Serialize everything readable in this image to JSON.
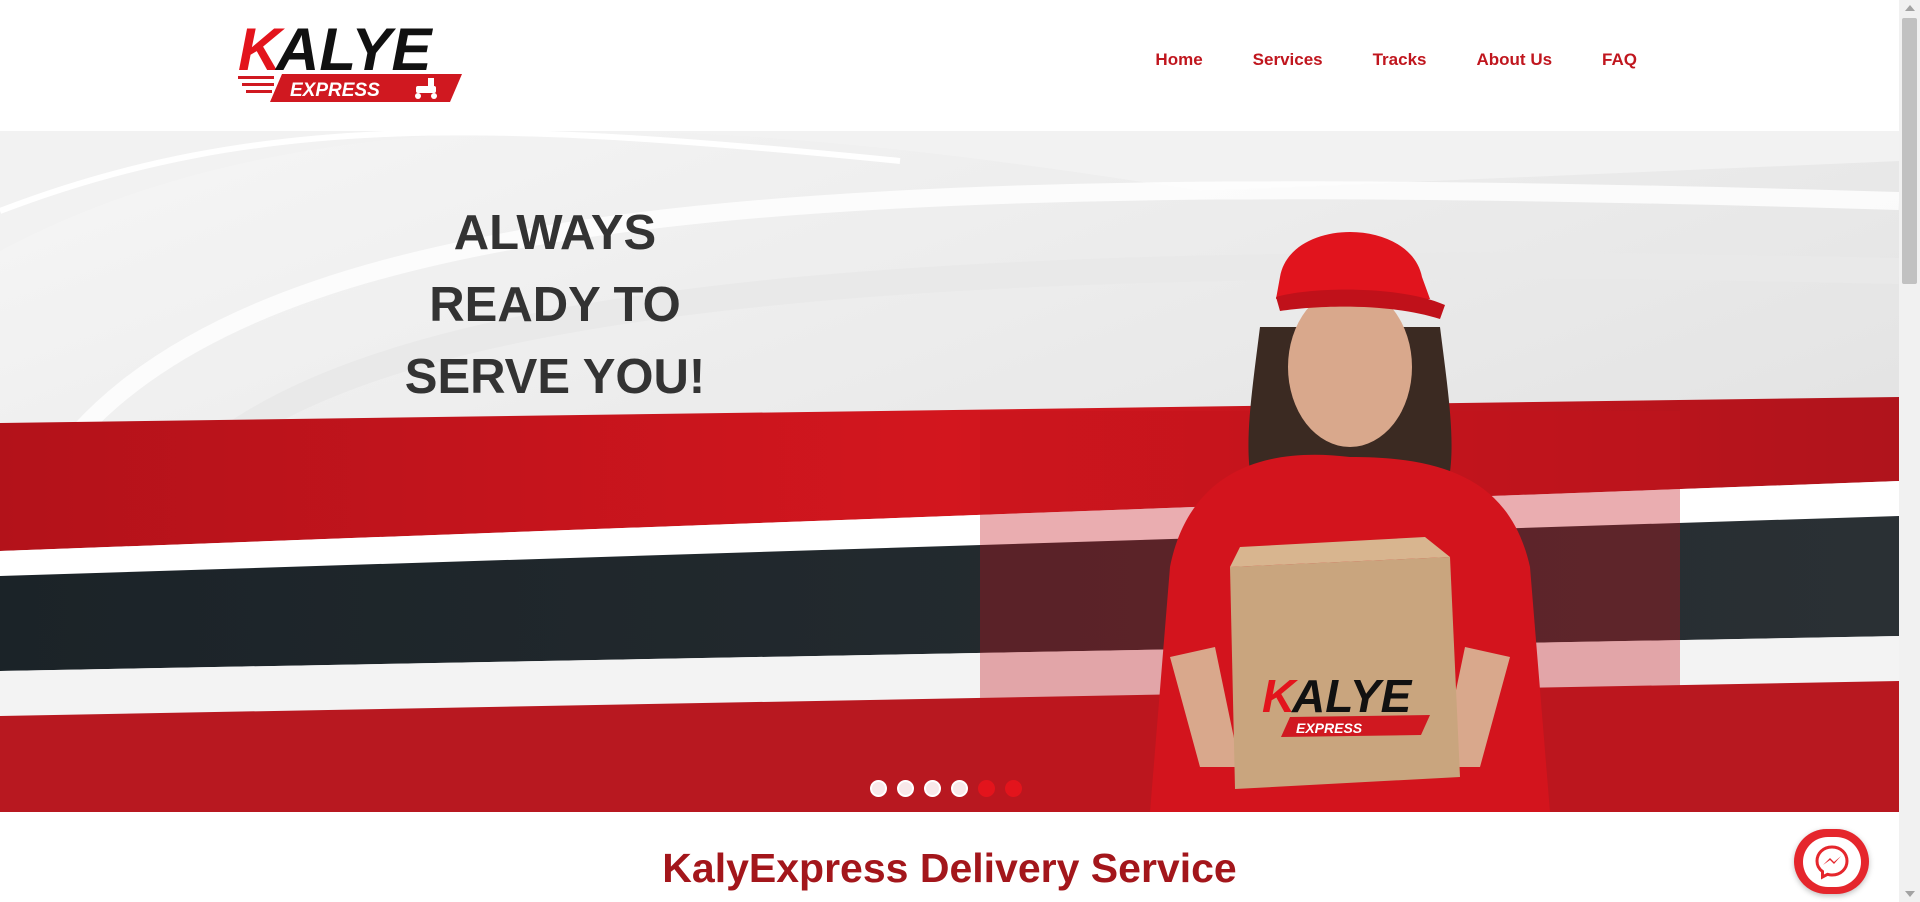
{
  "brand": {
    "logo_main": "KALYE",
    "logo_sub": "EXPRESS",
    "colors": {
      "primary_red": "#e3141c",
      "dark_red": "#a3161b",
      "dark_text": "#333333"
    }
  },
  "nav": {
    "items": [
      {
        "label": "Home"
      },
      {
        "label": "Services"
      },
      {
        "label": "Tracks"
      },
      {
        "label": "About Us"
      },
      {
        "label": "FAQ"
      }
    ]
  },
  "hero": {
    "headline_lines": [
      "ALWAYS",
      "READY TO",
      "SERVE YOU!"
    ],
    "box_logo_main": "KALYE",
    "box_logo_sub": "EXPRESS",
    "carousel": {
      "total_slides": 6,
      "active_slide": 5
    }
  },
  "section": {
    "title": "KalyExpress Delivery Service"
  },
  "icons": {
    "messenger": "messenger-icon",
    "scooter": "scooter-icon"
  }
}
